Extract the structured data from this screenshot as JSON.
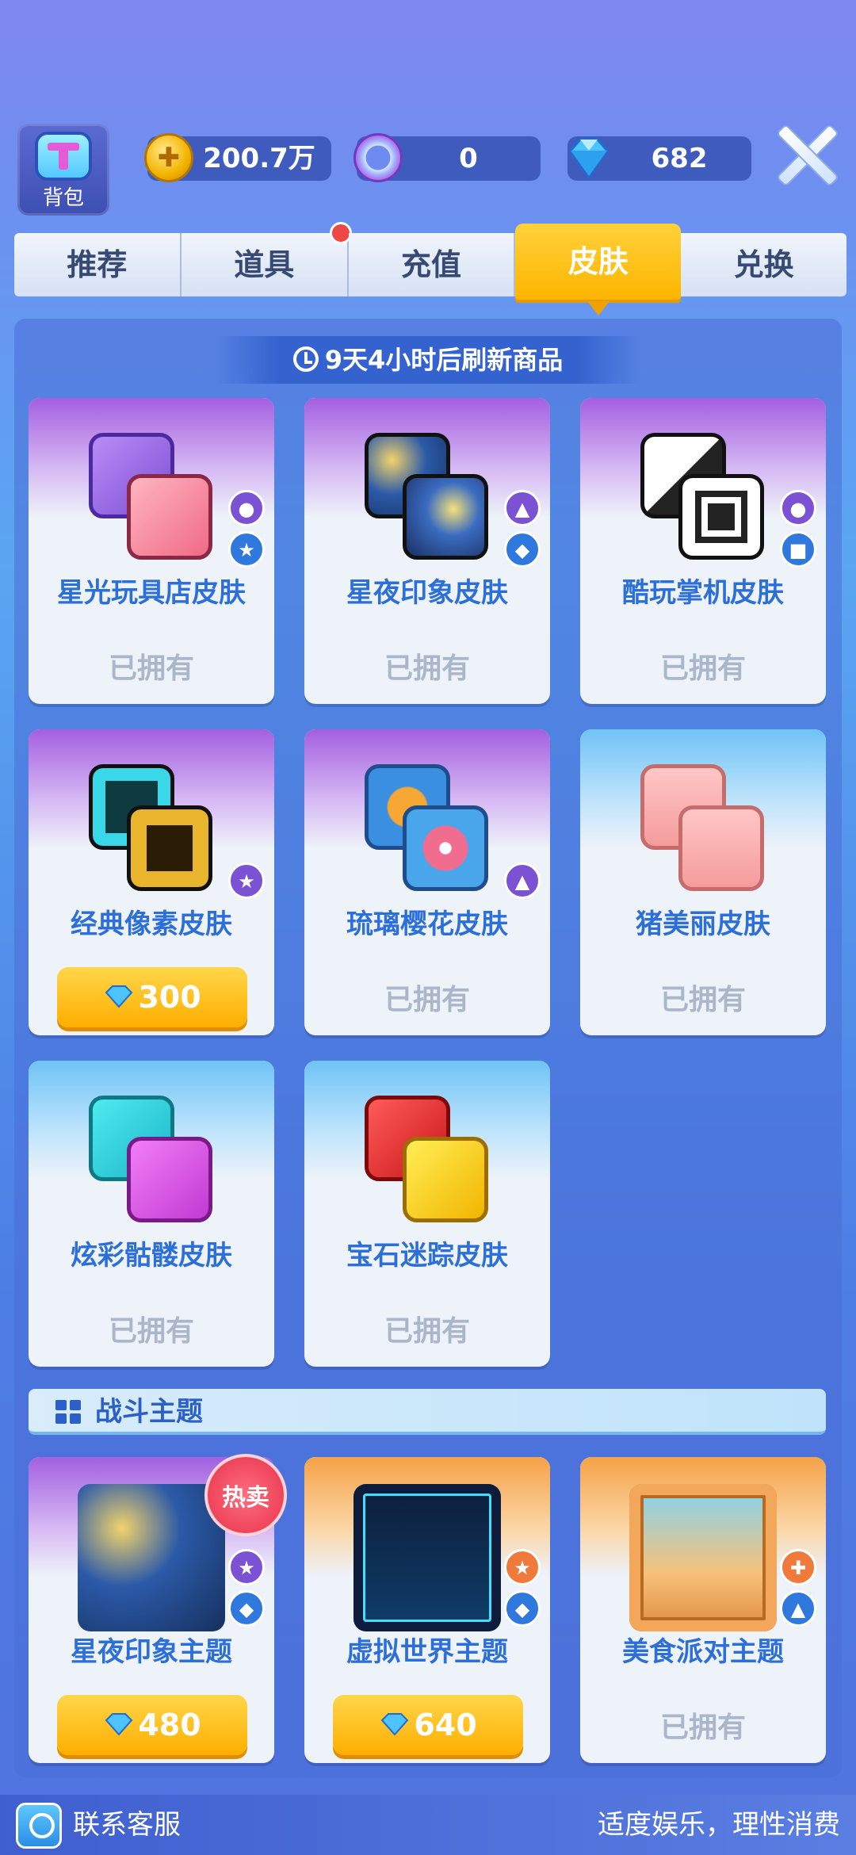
{
  "top_bar": {
    "bag_label": "背包",
    "gold": "200.7万",
    "ring": "0",
    "diamonds": "682"
  },
  "tabs": [
    {
      "label": "推荐"
    },
    {
      "label": "道具"
    },
    {
      "label": "充值"
    },
    {
      "label": "皮肤"
    },
    {
      "label": "兑换"
    }
  ],
  "active_tab": "皮肤",
  "refresh_text": "9天4小时后刷新商品",
  "skins": [
    {
      "title": "星光玩具店皮肤",
      "status": "已拥有"
    },
    {
      "title": "星夜印象皮肤",
      "status": "已拥有"
    },
    {
      "title": "酷玩掌机皮肤",
      "status": "已拥有"
    },
    {
      "title": "经典像素皮肤",
      "price": "300"
    },
    {
      "title": "琉璃樱花皮肤",
      "status": "已拥有"
    },
    {
      "title": "猪美丽皮肤",
      "status": "已拥有"
    },
    {
      "title": "炫彩骷髅皮肤",
      "status": "已拥有"
    },
    {
      "title": "宝石迷踪皮肤",
      "status": "已拥有"
    }
  ],
  "theme_section": {
    "title": "战斗主题",
    "hot_badge": "热卖",
    "items": [
      {
        "title": "星夜印象主题",
        "price": "480"
      },
      {
        "title": "虚拟世界主题",
        "price": "640"
      },
      {
        "title": "美食派对主题",
        "status": "已拥有"
      }
    ]
  },
  "bottom_bar": {
    "service": "联系客服",
    "motto": "适度娱乐，理性消费"
  },
  "colors": {
    "accent_gold": "#ffb400",
    "title_blue": "#2c6fd8",
    "owned_gray": "#aab6ca"
  }
}
